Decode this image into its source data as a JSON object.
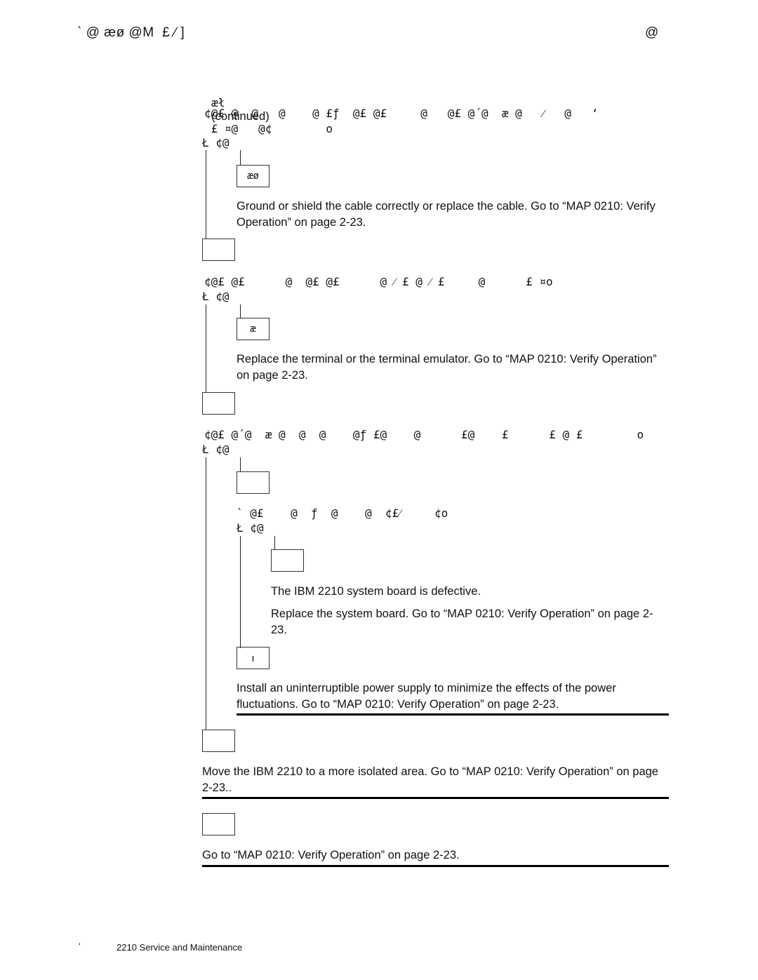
{
  "header": {
    "left": "` @ æø @M  £ ⁄ ]",
    "right": "@"
  },
  "section_label": {
    "glyphs": "æł",
    "continued": "(continued)"
  },
  "steps": [
    {
      "question_line1": "¢@£ @  @   @    @ £ƒ  @£ @£     @   @£ @´@  æ @   ⁄   @   ‘",
      "question_line2": " £ ¤@   @¢        o",
      "answer_row": "Ł ¢@",
      "yes_box": "æø",
      "yes_text": "Ground or shield the cable correctly or replace the cable.  Go to “MAP 0210:  Verify Operation” on page  2-23.",
      "no_box": ""
    },
    {
      "question_line1": "¢@£ @£      @  @£ @£      @ ⁄ £ @ ⁄ £     @      £ ¤o",
      "answer_row": "Ł ¢@",
      "yes_box": "æ",
      "yes_text": "Replace the terminal or the terminal emulator.  Go to “MAP 0210:  Verify Operation” on page  2-23.",
      "no_box": ""
    },
    {
      "question_line1": "¢@£ @´@  æ @  @  @    @ƒ £@    @      £@    £      £ @ £        o",
      "answer_row": "Ł ¢@",
      "yes_box": "",
      "sub_question": "` @£    @  ƒ  @    @  ¢£⁄     ¢o",
      "sub_answer_row": "Ł ¢@",
      "sub_yes_box": "",
      "sub_yes_text_1": "The IBM 2210 system board is defective.",
      "sub_yes_text_2": "Replace the system board.  Go to “MAP 0210:  Verify Operation” on page  2-23.",
      "sub_no_box": "ı",
      "sub_no_text": "Install an uninterruptible power supply to minimize the effects of the power fluctuations.  Go to “MAP 0210:  Verify Operation” on page  2-23.",
      "no_box": "",
      "no_text": "Move the IBM 2210 to a more isolated area.  Go to “MAP 0210:  Verify Operation” on page  2-23.."
    }
  ],
  "final": {
    "box": "",
    "text": "Go to “MAP 0210:  Verify Operation” on page  2-23."
  },
  "footer": {
    "page_glyph": "‘",
    "title": "2210 Service and Maintenance"
  }
}
